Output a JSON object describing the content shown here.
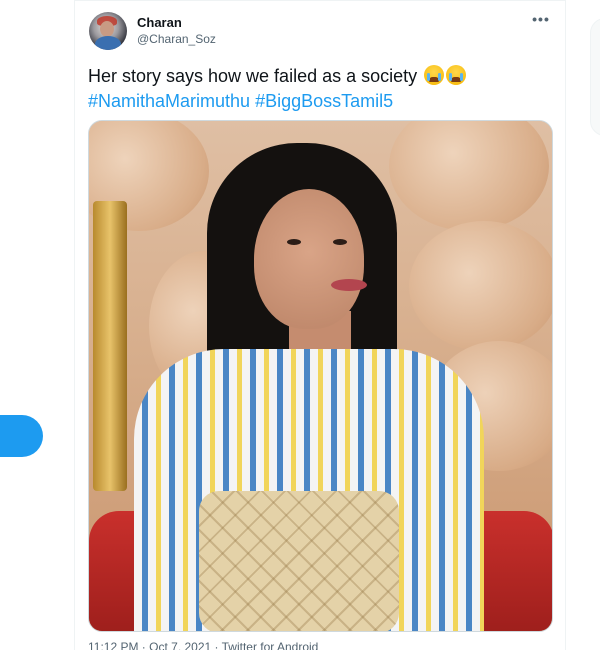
{
  "tweet": {
    "author_name": "Charan",
    "author_handle": "@Charan_Soz",
    "text": "Her story says how we failed as a society",
    "emojis": [
      "loudly-crying-face",
      "loudly-crying-face"
    ],
    "hashtags": [
      "#NamithaMarimuthu",
      "#BiggBossTamil5"
    ],
    "more_label": "•••",
    "media_description": "photo",
    "timestamp_partial": "11:12 PM · Oct 7, 2021 · Twitter for Android"
  },
  "colors": {
    "accent": "#1d9bf0",
    "text_primary": "#0f1419",
    "text_secondary": "#536471"
  }
}
